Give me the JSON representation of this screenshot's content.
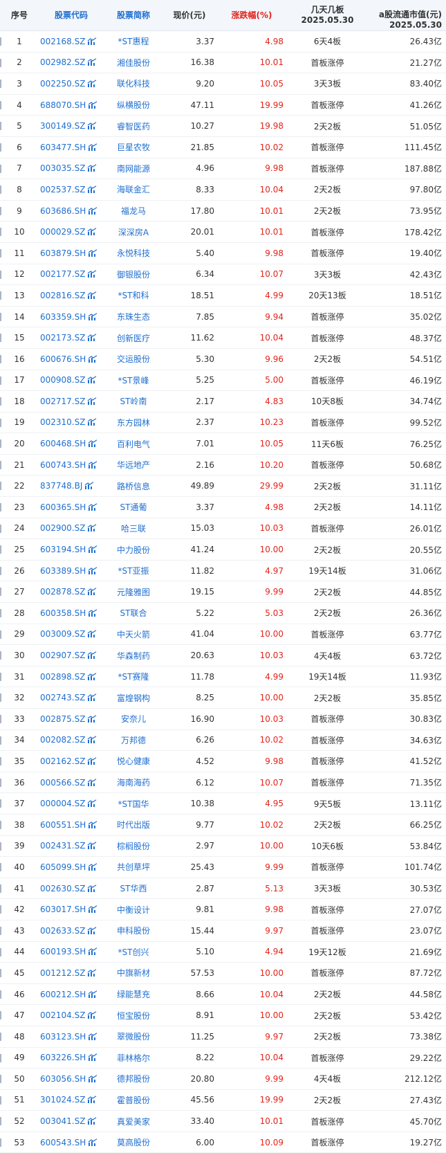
{
  "headers": {
    "idx": "序号",
    "code": "股票代码",
    "name": "股票简称",
    "price": "现价(元)",
    "chg": "涨跌幅(%)",
    "board_l1": "几天几板",
    "board_l2": "2025.05.30",
    "mv_l1": "a股流通市值(元)",
    "mv_l2": "2025.05.30"
  },
  "colors": {
    "link": "#1f6fd1",
    "up": "#e3231b",
    "header_bg": "#f3f6fb"
  },
  "icon": "kline-chart-icon",
  "rows": [
    {
      "idx": "1",
      "code": "002168.SZ",
      "name": "*ST惠程",
      "price": "3.37",
      "chg": "4.98",
      "board": "6天4板",
      "mv": "26.43亿"
    },
    {
      "idx": "2",
      "code": "002982.SZ",
      "name": "湘佳股份",
      "price": "16.38",
      "chg": "10.01",
      "board": "首板涨停",
      "mv": "21.27亿"
    },
    {
      "idx": "3",
      "code": "002250.SZ",
      "name": "联化科技",
      "price": "9.20",
      "chg": "10.05",
      "board": "3天3板",
      "mv": "83.40亿"
    },
    {
      "idx": "4",
      "code": "688070.SH",
      "name": "纵横股份",
      "price": "47.11",
      "chg": "19.99",
      "board": "首板涨停",
      "mv": "41.26亿"
    },
    {
      "idx": "5",
      "code": "300149.SZ",
      "name": "睿智医药",
      "price": "10.27",
      "chg": "19.98",
      "board": "2天2板",
      "mv": "51.05亿"
    },
    {
      "idx": "6",
      "code": "603477.SH",
      "name": "巨星农牧",
      "price": "21.85",
      "chg": "10.02",
      "board": "首板涨停",
      "mv": "111.45亿"
    },
    {
      "idx": "7",
      "code": "003035.SZ",
      "name": "南网能源",
      "price": "4.96",
      "chg": "9.98",
      "board": "首板涨停",
      "mv": "187.88亿"
    },
    {
      "idx": "8",
      "code": "002537.SZ",
      "name": "海联金汇",
      "price": "8.33",
      "chg": "10.04",
      "board": "2天2板",
      "mv": "97.80亿"
    },
    {
      "idx": "9",
      "code": "603686.SH",
      "name": "福龙马",
      "price": "17.80",
      "chg": "10.01",
      "board": "2天2板",
      "mv": "73.95亿"
    },
    {
      "idx": "10",
      "code": "000029.SZ",
      "name": "深深房A",
      "price": "20.01",
      "chg": "10.01",
      "board": "首板涨停",
      "mv": "178.42亿"
    },
    {
      "idx": "11",
      "code": "603879.SH",
      "name": "永悦科技",
      "price": "5.40",
      "chg": "9.98",
      "board": "首板涨停",
      "mv": "19.40亿"
    },
    {
      "idx": "12",
      "code": "002177.SZ",
      "name": "御银股份",
      "price": "6.34",
      "chg": "10.07",
      "board": "3天3板",
      "mv": "42.43亿"
    },
    {
      "idx": "13",
      "code": "002816.SZ",
      "name": "*ST和科",
      "price": "18.51",
      "chg": "4.99",
      "board": "20天13板",
      "mv": "18.51亿"
    },
    {
      "idx": "14",
      "code": "603359.SH",
      "name": "东珠生态",
      "price": "7.85",
      "chg": "9.94",
      "board": "首板涨停",
      "mv": "35.02亿"
    },
    {
      "idx": "15",
      "code": "002173.SZ",
      "name": "创新医疗",
      "price": "11.62",
      "chg": "10.04",
      "board": "首板涨停",
      "mv": "48.37亿"
    },
    {
      "idx": "16",
      "code": "600676.SH",
      "name": "交运股份",
      "price": "5.30",
      "chg": "9.96",
      "board": "2天2板",
      "mv": "54.51亿"
    },
    {
      "idx": "17",
      "code": "000908.SZ",
      "name": "*ST景峰",
      "price": "5.25",
      "chg": "5.00",
      "board": "首板涨停",
      "mv": "46.19亿"
    },
    {
      "idx": "18",
      "code": "002717.SZ",
      "name": "ST岭南",
      "price": "2.17",
      "chg": "4.83",
      "board": "10天8板",
      "mv": "34.74亿"
    },
    {
      "idx": "19",
      "code": "002310.SZ",
      "name": "东方园林",
      "price": "2.37",
      "chg": "10.23",
      "board": "首板涨停",
      "mv": "99.52亿"
    },
    {
      "idx": "20",
      "code": "600468.SH",
      "name": "百利电气",
      "price": "7.01",
      "chg": "10.05",
      "board": "11天6板",
      "mv": "76.25亿"
    },
    {
      "idx": "21",
      "code": "600743.SH",
      "name": "华远地产",
      "price": "2.16",
      "chg": "10.20",
      "board": "首板涨停",
      "mv": "50.68亿"
    },
    {
      "idx": "22",
      "code": "837748.BJ",
      "name": "路桥信息",
      "price": "49.89",
      "chg": "29.99",
      "board": "2天2板",
      "mv": "31.11亿"
    },
    {
      "idx": "23",
      "code": "600365.SH",
      "name": "ST通葡",
      "price": "3.37",
      "chg": "4.98",
      "board": "2天2板",
      "mv": "14.11亿"
    },
    {
      "idx": "24",
      "code": "002900.SZ",
      "name": "哈三联",
      "price": "15.03",
      "chg": "10.03",
      "board": "首板涨停",
      "mv": "26.01亿"
    },
    {
      "idx": "25",
      "code": "603194.SH",
      "name": "中力股份",
      "price": "41.24",
      "chg": "10.00",
      "board": "2天2板",
      "mv": "20.55亿"
    },
    {
      "idx": "26",
      "code": "603389.SH",
      "name": "*ST亚振",
      "price": "11.82",
      "chg": "4.97",
      "board": "19天14板",
      "mv": "31.06亿"
    },
    {
      "idx": "27",
      "code": "002878.SZ",
      "name": "元隆雅图",
      "price": "19.15",
      "chg": "9.99",
      "board": "2天2板",
      "mv": "44.85亿"
    },
    {
      "idx": "28",
      "code": "600358.SH",
      "name": "ST联合",
      "price": "5.22",
      "chg": "5.03",
      "board": "2天2板",
      "mv": "26.36亿"
    },
    {
      "idx": "29",
      "code": "003009.SZ",
      "name": "中天火箭",
      "price": "41.04",
      "chg": "10.00",
      "board": "首板涨停",
      "mv": "63.77亿"
    },
    {
      "idx": "30",
      "code": "002907.SZ",
      "name": "华森制药",
      "price": "20.63",
      "chg": "10.03",
      "board": "4天4板",
      "mv": "63.72亿"
    },
    {
      "idx": "31",
      "code": "002898.SZ",
      "name": "*ST赛隆",
      "price": "11.78",
      "chg": "4.99",
      "board": "19天14板",
      "mv": "11.93亿"
    },
    {
      "idx": "32",
      "code": "002743.SZ",
      "name": "富煌钢构",
      "price": "8.25",
      "chg": "10.00",
      "board": "2天2板",
      "mv": "35.85亿"
    },
    {
      "idx": "33",
      "code": "002875.SZ",
      "name": "安奈儿",
      "price": "16.90",
      "chg": "10.03",
      "board": "首板涨停",
      "mv": "30.83亿"
    },
    {
      "idx": "34",
      "code": "002082.SZ",
      "name": "万邦德",
      "price": "6.26",
      "chg": "10.02",
      "board": "首板涨停",
      "mv": "34.63亿"
    },
    {
      "idx": "35",
      "code": "002162.SZ",
      "name": "悦心健康",
      "price": "4.52",
      "chg": "9.98",
      "board": "首板涨停",
      "mv": "41.52亿"
    },
    {
      "idx": "36",
      "code": "000566.SZ",
      "name": "海南海药",
      "price": "6.12",
      "chg": "10.07",
      "board": "首板涨停",
      "mv": "71.35亿"
    },
    {
      "idx": "37",
      "code": "000004.SZ",
      "name": "*ST国华",
      "price": "10.38",
      "chg": "4.95",
      "board": "9天5板",
      "mv": "13.11亿"
    },
    {
      "idx": "38",
      "code": "600551.SH",
      "name": "时代出版",
      "price": "9.77",
      "chg": "10.02",
      "board": "2天2板",
      "mv": "66.25亿"
    },
    {
      "idx": "39",
      "code": "002431.SZ",
      "name": "棕榈股份",
      "price": "2.97",
      "chg": "10.00",
      "board": "10天6板",
      "mv": "53.84亿"
    },
    {
      "idx": "40",
      "code": "605099.SH",
      "name": "共创草坪",
      "price": "25.43",
      "chg": "9.99",
      "board": "首板涨停",
      "mv": "101.74亿"
    },
    {
      "idx": "41",
      "code": "002630.SZ",
      "name": "ST华西",
      "price": "2.87",
      "chg": "5.13",
      "board": "3天3板",
      "mv": "30.53亿"
    },
    {
      "idx": "42",
      "code": "603017.SH",
      "name": "中衡设计",
      "price": "9.81",
      "chg": "9.98",
      "board": "首板涨停",
      "mv": "27.07亿"
    },
    {
      "idx": "43",
      "code": "002633.SZ",
      "name": "申科股份",
      "price": "15.44",
      "chg": "9.97",
      "board": "首板涨停",
      "mv": "23.07亿"
    },
    {
      "idx": "44",
      "code": "600193.SH",
      "name": "*ST创兴",
      "price": "5.10",
      "chg": "4.94",
      "board": "19天12板",
      "mv": "21.69亿"
    },
    {
      "idx": "45",
      "code": "001212.SZ",
      "name": "中旗新材",
      "price": "57.53",
      "chg": "10.00",
      "board": "首板涨停",
      "mv": "87.72亿"
    },
    {
      "idx": "46",
      "code": "600212.SH",
      "name": "绿能慧充",
      "price": "8.66",
      "chg": "10.04",
      "board": "2天2板",
      "mv": "44.58亿"
    },
    {
      "idx": "47",
      "code": "002104.SZ",
      "name": "恒宝股份",
      "price": "8.91",
      "chg": "10.00",
      "board": "2天2板",
      "mv": "53.42亿"
    },
    {
      "idx": "48",
      "code": "603123.SH",
      "name": "翠微股份",
      "price": "11.25",
      "chg": "9.97",
      "board": "2天2板",
      "mv": "73.38亿"
    },
    {
      "idx": "49",
      "code": "603226.SH",
      "name": "菲林格尔",
      "price": "8.22",
      "chg": "10.04",
      "board": "首板涨停",
      "mv": "29.22亿"
    },
    {
      "idx": "50",
      "code": "603056.SH",
      "name": "德邦股份",
      "price": "20.80",
      "chg": "9.99",
      "board": "4天4板",
      "mv": "212.12亿"
    },
    {
      "idx": "51",
      "code": "301024.SZ",
      "name": "霍普股份",
      "price": "45.56",
      "chg": "19.99",
      "board": "2天2板",
      "mv": "27.43亿"
    },
    {
      "idx": "52",
      "code": "003041.SZ",
      "name": "真爱美家",
      "price": "33.40",
      "chg": "10.01",
      "board": "首板涨停",
      "mv": "45.70亿"
    },
    {
      "idx": "53",
      "code": "600543.SH",
      "name": "莫高股份",
      "price": "6.00",
      "chg": "10.09",
      "board": "首板涨停",
      "mv": "19.27亿"
    }
  ]
}
